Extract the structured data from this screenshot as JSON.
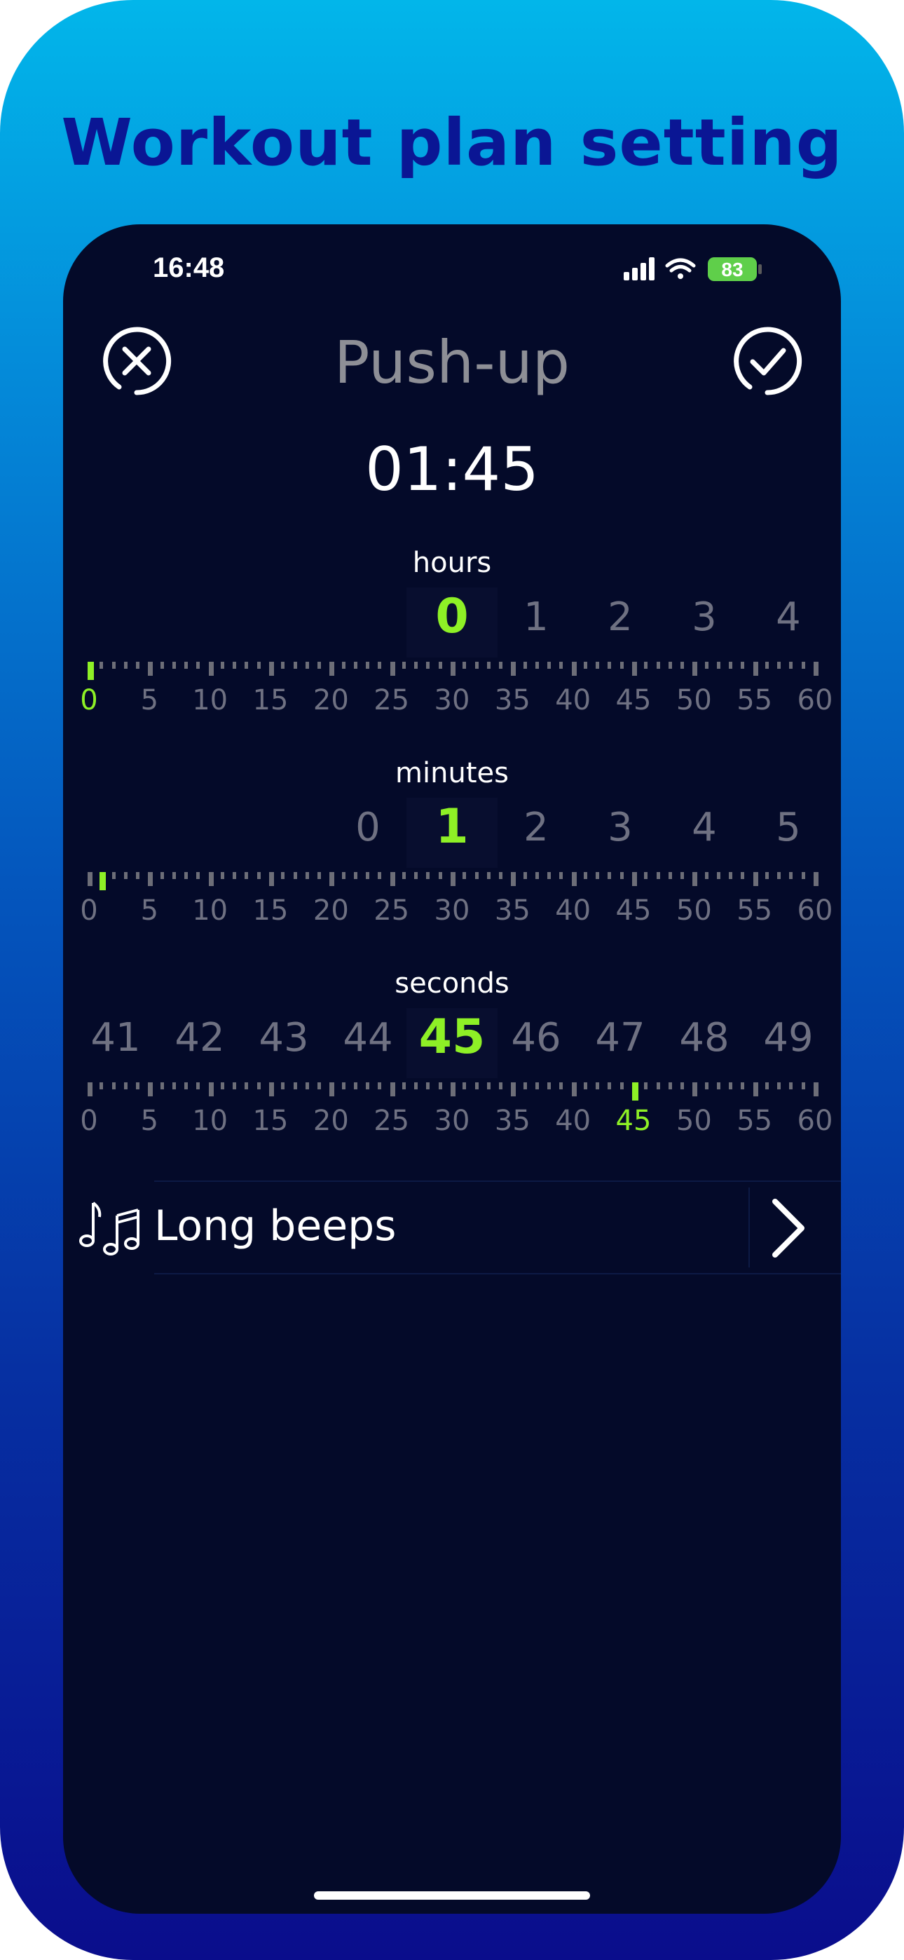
{
  "promo": {
    "title": "Workout plan setting"
  },
  "status": {
    "time": "16:48",
    "battery": "83"
  },
  "header": {
    "title": "Push-up",
    "close_icon": "close-icon",
    "confirm_icon": "check-icon"
  },
  "total_time": "01:45",
  "pickers": [
    {
      "label": "hours",
      "wheel": [
        "",
        "",
        "",
        "",
        "0",
        "1",
        "2",
        "3",
        "4"
      ],
      "selected": "0",
      "ruler_labels": [
        "0",
        "5",
        "10",
        "15",
        "20",
        "25",
        "30",
        "35",
        "40",
        "45",
        "50",
        "55",
        "60"
      ],
      "selected_value": 0
    },
    {
      "label": "minutes",
      "wheel": [
        "",
        "",
        "",
        "0",
        "1",
        "2",
        "3",
        "4",
        "5"
      ],
      "selected": "1",
      "ruler_labels": [
        "0",
        "5",
        "10",
        "15",
        "20",
        "25",
        "30",
        "35",
        "40",
        "45",
        "50",
        "55",
        "60"
      ],
      "selected_value": 1
    },
    {
      "label": "seconds",
      "wheel": [
        "41",
        "42",
        "43",
        "44",
        "45",
        "46",
        "47",
        "48",
        "49"
      ],
      "selected": "45",
      "ruler_labels": [
        "0",
        "5",
        "10",
        "15",
        "20",
        "25",
        "30",
        "35",
        "40",
        "45",
        "50",
        "55",
        "60"
      ],
      "selected_value": 45
    }
  ],
  "sound": {
    "label": "Long beeps",
    "icon": "music-notes-icon",
    "chevron_icon": "chevron-right-icon"
  },
  "colors": {
    "accent": "#8ef026",
    "background": "#040a29",
    "inactive": "#6f7182"
  }
}
